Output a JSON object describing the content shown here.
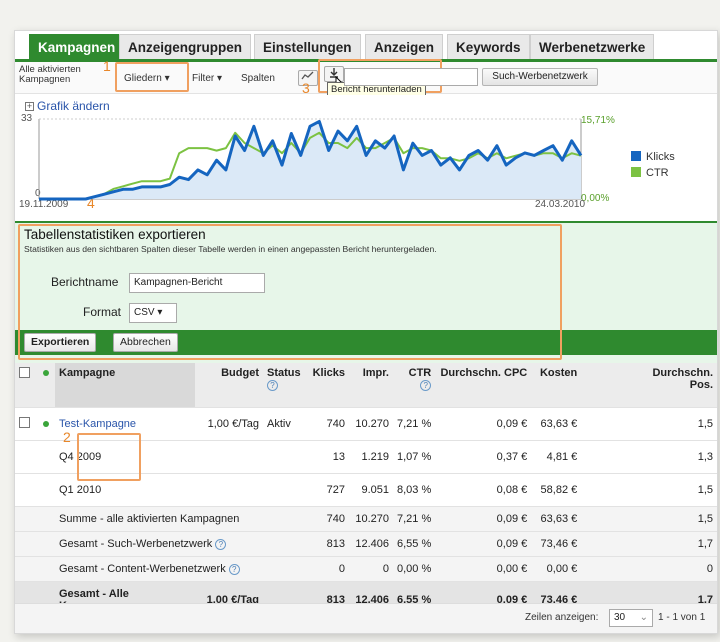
{
  "tabs": [
    {
      "label": "Kampagnen",
      "active": true
    },
    {
      "label": "Anzeigengruppen"
    },
    {
      "label": "Einstellungen"
    },
    {
      "label": "Anzeigen"
    },
    {
      "label": "Keywords"
    },
    {
      "label": "Werbenetzwerke"
    }
  ],
  "toolbar": {
    "filter_scope": "Alle aktivierten\nKampagnen",
    "gliedern": "Gliedern ▾",
    "filter": "Filter ▾",
    "spalten": "Spalten",
    "search_value": "",
    "search_button": "Such-Werbenetzwerk",
    "tooltip": "Bericht herunterladen"
  },
  "annotations": {
    "n1": "1",
    "n2": "2",
    "n3": "3",
    "n4": "4"
  },
  "chart": {
    "grafik_link": "Grafik ändern",
    "y_left_max": "33",
    "y_left_min": "0",
    "y_right_max": "15,71%",
    "y_right_min": "0,00%",
    "x_start": "19.11.2009",
    "x_end": "24.03.2010",
    "legend": [
      {
        "label": "Klicks",
        "color": "#1565c0"
      },
      {
        "label": "CTR",
        "color": "#7cc242"
      }
    ]
  },
  "chart_data": {
    "type": "line",
    "x_range": [
      "19.11.2009",
      "24.03.2010"
    ],
    "ylim_left": [
      0,
      33
    ],
    "ylim_right": [
      0,
      15.71
    ],
    "series": [
      {
        "name": "Klicks",
        "axis": "left",
        "color": "#1565c0",
        "values": [
          0,
          0,
          0,
          0,
          0,
          0,
          1,
          2,
          3,
          4,
          4,
          5,
          5,
          5,
          6,
          9,
          8,
          12,
          10,
          16,
          12,
          26,
          20,
          30,
          18,
          24,
          14,
          27,
          18,
          30,
          32,
          20,
          28,
          24,
          30,
          18,
          24,
          21,
          26,
          12,
          23,
          18,
          20,
          14,
          17,
          12,
          18,
          20,
          16,
          22,
          14,
          17,
          19,
          18,
          20,
          22,
          16,
          24,
          18
        ]
      },
      {
        "name": "CTR",
        "axis": "right",
        "color": "#7cc242",
        "values": [
          0,
          0,
          0,
          0,
          0,
          0,
          0.5,
          1,
          2,
          2.5,
          3,
          3.5,
          3.5,
          3.5,
          4,
          9,
          10,
          10,
          10,
          9.5,
          10,
          13,
          11,
          10,
          9,
          10.5,
          9,
          11,
          9,
          12,
          13,
          11,
          11,
          10,
          12,
          10,
          10,
          11,
          12,
          9,
          10,
          10,
          9.5,
          8,
          8,
          7.5,
          8,
          9,
          8,
          9,
          8,
          8.5,
          9,
          8.5,
          9,
          9,
          8,
          9,
          8.5
        ]
      }
    ]
  },
  "export": {
    "title": "Tabellenstatistiken exportieren",
    "description": "Statistiken aus den sichtbaren Spalten dieser Tabelle werden in einen angepassten Bericht heruntergeladen.",
    "name_label": "Berichtname",
    "name_value": "Kampagnen-Bericht",
    "format_label": "Format",
    "format_value": "CSV ▾",
    "export_button": "Exportieren",
    "cancel_button": "Abbrechen"
  },
  "table": {
    "headers": {
      "kampagne": "Kampagne",
      "budget": "Budget",
      "status": "Status",
      "klicks": "Klicks",
      "impr": "Impr.",
      "ctr": "CTR",
      "cpc": "Durchschn. CPC",
      "kosten": "Kosten",
      "pos": "Durchschn.\nPos."
    },
    "help_icon": "?",
    "rows": [
      {
        "name": "Test-Kampagne",
        "budget": "1,00 €/Tag",
        "status": "Aktiv",
        "klicks": "740",
        "impr": "10.270",
        "ctr": "7,21 %",
        "cpc": "0,09 €",
        "kosten": "63,63 €",
        "pos": "1,5"
      },
      {
        "name": "Q4 2009",
        "budget": "",
        "status": "",
        "klicks": "13",
        "impr": "1.219",
        "ctr": "1,07 %",
        "cpc": "0,37 €",
        "kosten": "4,81 €",
        "pos": "1,3"
      },
      {
        "name": "Q1 2010",
        "budget": "",
        "status": "",
        "klicks": "727",
        "impr": "9.051",
        "ctr": "8,03 %",
        "cpc": "0,08 €",
        "kosten": "58,82 €",
        "pos": "1,5"
      },
      {
        "name": "Summe - alle aktivierten Kampagnen",
        "budget": "",
        "status": "",
        "klicks": "740",
        "impr": "10.270",
        "ctr": "7,21 %",
        "cpc": "0,09 €",
        "kosten": "63,63 €",
        "pos": "1,5"
      },
      {
        "name": "Gesamt - Such-Werbenetzwerk",
        "budget": "",
        "status": "",
        "klicks": "813",
        "impr": "12.406",
        "ctr": "6,55 %",
        "cpc": "0,09 €",
        "kosten": "73,46 €",
        "pos": "1,7"
      },
      {
        "name": "Gesamt - Content-Werbenetzwerk",
        "budget": "",
        "status": "",
        "klicks": "0",
        "impr": "0",
        "ctr": "0,00 %",
        "cpc": "0,00 €",
        "kosten": "0,00 €",
        "pos": "0"
      },
      {
        "name": "Gesamt - Alle\nKampagnen",
        "budget": "1,00 €/Tag",
        "status": "",
        "klicks": "813",
        "impr": "12.406",
        "ctr": "6,55 %",
        "cpc": "0,09 €",
        "kosten": "73,46 €",
        "pos": "1,7"
      }
    ]
  },
  "footer": {
    "rows_label": "Zeilen anzeigen:",
    "rows_value": "30",
    "range": "1 - 1 von 1"
  }
}
